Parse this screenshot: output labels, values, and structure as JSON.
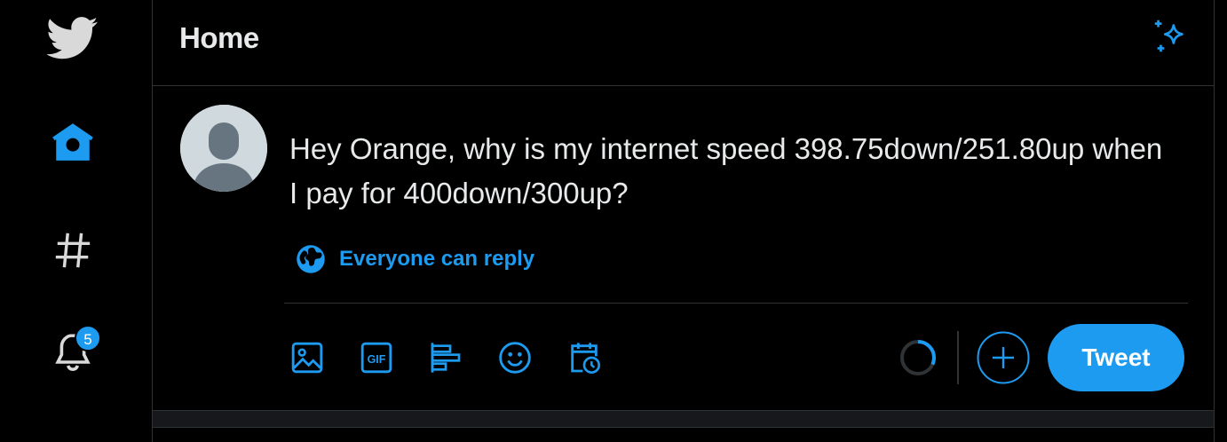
{
  "nav": {
    "logo_icon": "twitter-bird-icon",
    "items": [
      {
        "icon": "home-icon",
        "active": true
      },
      {
        "icon": "hashtag-icon",
        "active": false
      },
      {
        "icon": "bell-icon",
        "badge": "5"
      }
    ]
  },
  "header": {
    "title": "Home",
    "sparkle_icon": "sparkle-icon"
  },
  "compose": {
    "avatar_icon": "default-avatar",
    "text": "Hey Orange, why is my internet speed 398.75down/251.80up when I pay for 400down/300up?",
    "reply_setting": "Everyone can reply",
    "tools": [
      "image-icon",
      "gif-icon",
      "poll-icon",
      "emoji-icon",
      "schedule-icon"
    ],
    "tweet_label": "Tweet"
  },
  "colors": {
    "accent": "#1d9bf0",
    "background": "#000000",
    "border": "#2f3336",
    "text": "#e7e9ea"
  }
}
